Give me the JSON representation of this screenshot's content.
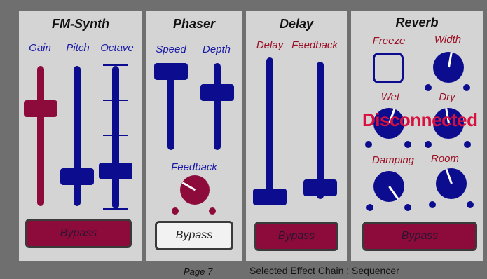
{
  "fm_synth": {
    "title": "FM-Synth",
    "gain_label": "Gain",
    "pitch_label": "Pitch",
    "octave_label": "Octave",
    "bypass_label": "Bypass",
    "bypass_active": true,
    "gain_level": 0.72,
    "pitch_level": 0.2,
    "octave_level": 0.25
  },
  "phaser": {
    "title": "Phaser",
    "speed_label": "Speed",
    "depth_label": "Depth",
    "feedback_label": "Feedback",
    "bypass_label": "Bypass",
    "bypass_active": false,
    "speed_level": 0.9,
    "depth_level": 0.62
  },
  "delay": {
    "title": "Delay",
    "delay_label": "Delay",
    "feedback_label": "Feedback",
    "bypass_label": "Bypass",
    "bypass_active": true,
    "delay_level": 0.02,
    "feedback_level": 0.1
  },
  "reverb": {
    "title": "Reverb",
    "freeze_label": "Freeze",
    "width_label": "Width",
    "wet_label": "Wet",
    "dry_label": "Dry",
    "damping_label": "Damping",
    "room_label": "Room",
    "bypass_label": "Bypass",
    "bypass_active": true,
    "status_text": "Disconnected"
  },
  "footer": {
    "page_label": "Page 7",
    "selected_chain": "Selected Effect Chain : Sequencer"
  },
  "colors": {
    "panel_bg": "#d4d4d4",
    "control_blue": "#0c0c8e",
    "control_red": "#8d0b3a",
    "label_blue": "#1a1aa6",
    "label_red": "#9a0f24",
    "status_red": "#d8103e"
  }
}
